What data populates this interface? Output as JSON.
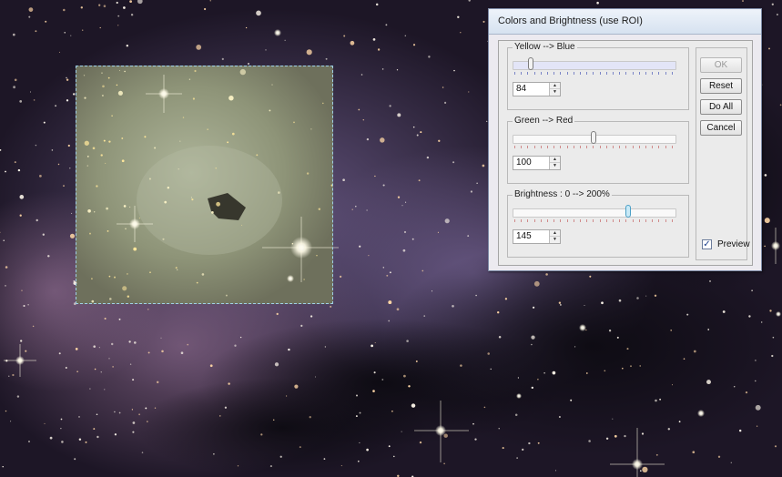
{
  "dialog": {
    "title": "Colors and Brightness (use ROI)",
    "groups": [
      {
        "label": "Yellow --> Blue",
        "value": "84",
        "level": 0.1
      },
      {
        "label": "Green  --> Red",
        "value": "100",
        "level": 0.5
      },
      {
        "label": "Brightness :  0  --> 200%",
        "value": "145",
        "level": 0.72
      }
    ],
    "buttons": {
      "ok": "OK",
      "reset": "Reset",
      "do_all": "Do All",
      "cancel": "Cancel"
    },
    "preview_label": "Preview",
    "preview_checked": "✓"
  }
}
